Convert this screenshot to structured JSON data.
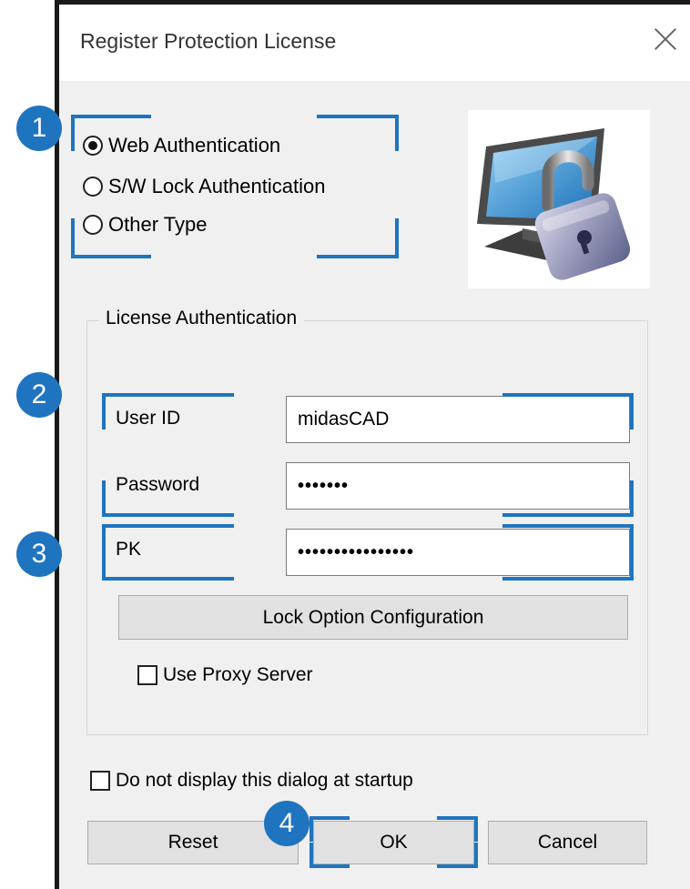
{
  "window": {
    "title": "Register Protection License",
    "close_icon": "close-icon"
  },
  "auth_type": {
    "options": [
      {
        "label": "Web Authentication",
        "checked": true
      },
      {
        "label": "S/W Lock Authentication",
        "checked": false
      },
      {
        "label": "Other Type",
        "checked": false
      }
    ]
  },
  "license_group": {
    "title": "License Authentication",
    "user_id_label": "User ID",
    "user_id_value": "midasCAD",
    "password_label": "Password",
    "password_value": "•••••••",
    "pk_label": "PK",
    "pk_value": "••••••••••••••••",
    "lock_option_button": "Lock Option Configuration",
    "use_proxy_label": "Use Proxy Server"
  },
  "footer": {
    "startup_label": "Do not display this dialog at startup",
    "reset_label": "Reset",
    "ok_label": "OK",
    "cancel_label": "Cancel"
  },
  "callouts": [
    "1",
    "2",
    "3",
    "4"
  ],
  "colors": {
    "callout_blue": "#1f74c0",
    "dialog_bg": "#f0f0f0",
    "button_bg": "#e1e1e1"
  }
}
